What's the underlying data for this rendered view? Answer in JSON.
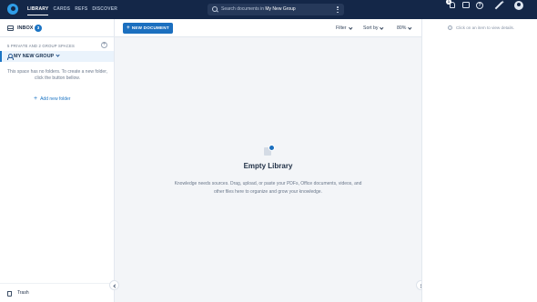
{
  "nav": {
    "items": [
      "LIBRARY",
      "CARDS",
      "REFS",
      "DISCOVER"
    ],
    "active": "LIBRARY"
  },
  "search": {
    "prefix": "Search documents in",
    "scope": "My New Group"
  },
  "topbar": {
    "notification_count": "1",
    "help_glyph": "?",
    "icons": [
      "bell-icon",
      "chat-icon",
      "help-icon",
      "magic-wand-icon",
      "avatar-icon"
    ]
  },
  "sidebar": {
    "inbox_label": "INBOX",
    "inbox_count": "3",
    "spaces_header": "5 PRIVATE AND 2 GROUP SPACES",
    "group_name": "MY NEW GROUP",
    "empty_folders_text": "This space has no folders. To create a new folder, click the button bellow.",
    "add_folder_label": "Add new folder",
    "trash_label": "Trash"
  },
  "toolbar": {
    "new_document_label": "NEW DOCUMENT",
    "filter_label": "Filter",
    "sort_label": "Sort by",
    "zoom_label": "80%"
  },
  "main": {
    "empty_title": "Empty Library",
    "empty_description": "Knowledge needs sources. Drag, upload, or paste your PDFs, Office documents, videos, and other files here to organize and grow your knowledge."
  },
  "details_panel": {
    "hint": "Click on an item to view details."
  },
  "colors": {
    "topbar": "#142748",
    "accent": "#1b6fbf",
    "background": "#f3f5f8"
  }
}
